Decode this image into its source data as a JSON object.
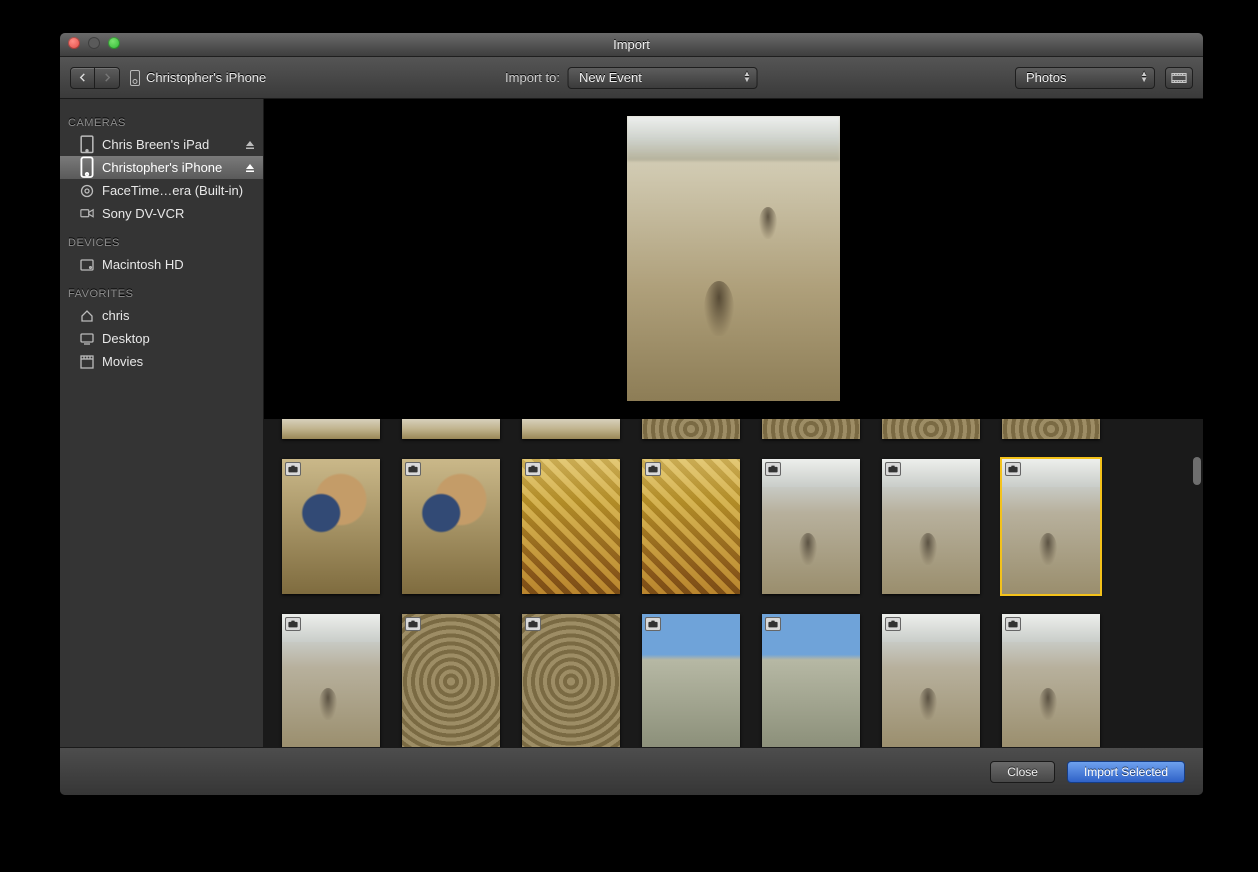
{
  "window": {
    "title": "Import"
  },
  "toolbar": {
    "device_label": "Christopher's iPhone",
    "import_to_label": "Import to:",
    "import_to_value": "New Event",
    "view_select_value": "Photos"
  },
  "sidebar": {
    "sections": [
      {
        "header": "CAMERAS",
        "items": [
          {
            "label": "Chris Breen's iPad",
            "icon": "ipad",
            "ejectable": true,
            "selected": false
          },
          {
            "label": "Christopher's iPhone",
            "icon": "iphone",
            "ejectable": true,
            "selected": true
          },
          {
            "label": "FaceTime…era (Built-in)",
            "icon": "webcam",
            "ejectable": false,
            "selected": false
          },
          {
            "label": "Sony DV-VCR",
            "icon": "camcorder",
            "ejectable": false,
            "selected": false
          }
        ]
      },
      {
        "header": "DEVICES",
        "items": [
          {
            "label": "Macintosh HD",
            "icon": "hdd",
            "ejectable": false,
            "selected": false
          }
        ]
      },
      {
        "header": "FAVORITES",
        "items": [
          {
            "label": "chris",
            "icon": "home",
            "ejectable": false,
            "selected": false
          },
          {
            "label": "Desktop",
            "icon": "desktop",
            "ejectable": false,
            "selected": false
          },
          {
            "label": "Movies",
            "icon": "movies",
            "ejectable": false,
            "selected": false
          }
        ]
      }
    ]
  },
  "thumbnails": {
    "row0_variants": [
      "sand",
      "sand",
      "sand",
      "gravel",
      "gravel",
      "gravel",
      "gravel"
    ],
    "row1_variants": [
      "shells",
      "shells",
      "kelp",
      "kelp",
      "wave",
      "wave",
      "wave"
    ],
    "row2_variants": [
      "wave",
      "gravel",
      "gravel",
      "ocean",
      "ocean",
      "wave",
      "wave"
    ],
    "selected_index_row1": 6
  },
  "footer": {
    "close_label": "Close",
    "import_label": "Import Selected"
  },
  "icons": {
    "camera": "camera-icon"
  }
}
